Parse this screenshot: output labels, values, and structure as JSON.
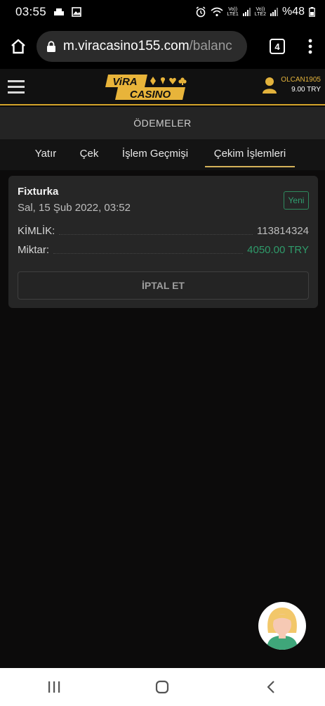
{
  "status_bar": {
    "time": "03:55",
    "battery": "%48",
    "volte1": "Vo))",
    "lte1": "LTE1",
    "volte2": "Vo))",
    "lte2": "LTE2"
  },
  "browser": {
    "url_main": "m.viracasino155.com",
    "url_rest": "/balanc",
    "tab_count": "4"
  },
  "header": {
    "logo_top": "ViRA",
    "logo_bottom": "CASINO",
    "username": "OLCAN1905",
    "balance": "9.00 TRY"
  },
  "page": {
    "section_title": "ÖDEMELER",
    "tabs": [
      {
        "label": "Yatır"
      },
      {
        "label": "Çek"
      },
      {
        "label": "İşlem Geçmişi"
      },
      {
        "label": "Çekim İşlemleri",
        "active": true
      }
    ]
  },
  "withdrawal": {
    "method": "Fixturka",
    "date": "Sal, 15 Şub 2022, 03:52",
    "status": "Yeni",
    "id_label": "KİMLİK:",
    "id_value": "113814324",
    "amount_label": "Miktar:",
    "amount_value": "4050.00 TRY",
    "cancel_label": "İPTAL ET"
  },
  "colors": {
    "accent_gold": "#d4a42b",
    "status_green": "#2fa070",
    "card_bg": "#262626",
    "page_bg": "#0c0b0b"
  },
  "icons": {
    "home": "home-icon",
    "lock": "lock-icon",
    "menu": "more-vert-icon",
    "user": "user-icon",
    "support": "support-avatar"
  }
}
